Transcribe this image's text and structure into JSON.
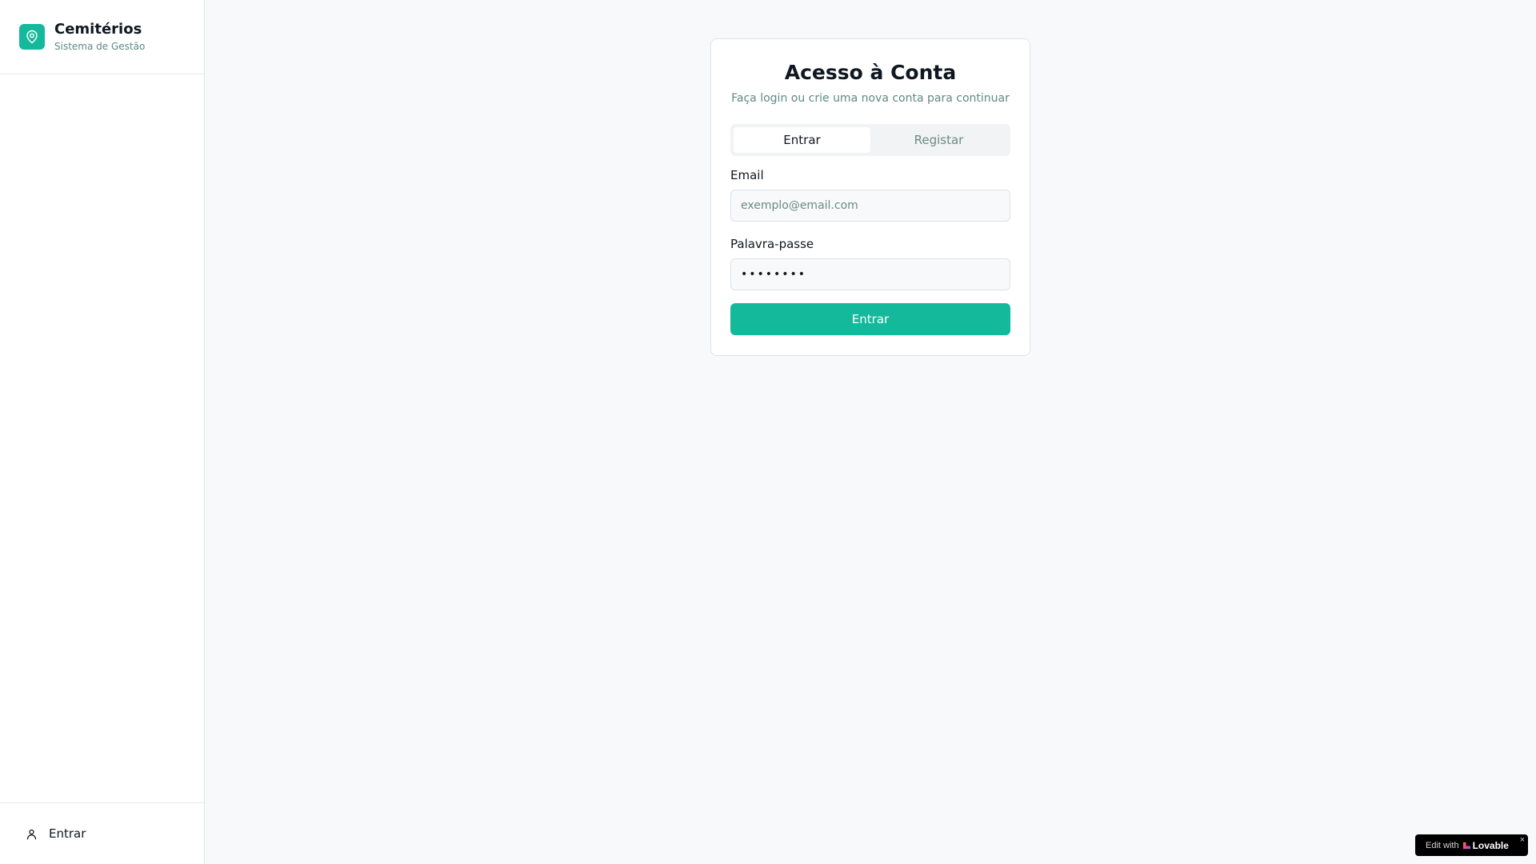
{
  "sidebar": {
    "brand": {
      "title": "Cemitérios",
      "subtitle": "Sistema de Gestão",
      "logo_icon": "map-pin-icon",
      "logo_color": "#14b89a"
    },
    "footer": {
      "login_label": "Entrar",
      "login_icon": "user-icon"
    }
  },
  "auth_card": {
    "title": "Acesso à Conta",
    "subtitle": "Faça login ou crie uma nova conta para continuar",
    "tabs": [
      {
        "label": "Entrar",
        "active": true
      },
      {
        "label": "Registar",
        "active": false
      }
    ],
    "email": {
      "label": "Email",
      "placeholder": "exemplo@email.com",
      "value": ""
    },
    "password": {
      "label": "Palavra-passe",
      "placeholder": "••••••••",
      "value": ""
    },
    "submit_label": "Entrar"
  },
  "badge": {
    "edit_text": "Edit with",
    "brand": "Lovable",
    "close": "×"
  },
  "colors": {
    "accent": "#14b89a",
    "muted_text": "#5f8a80",
    "background": "#f8f9fa"
  }
}
